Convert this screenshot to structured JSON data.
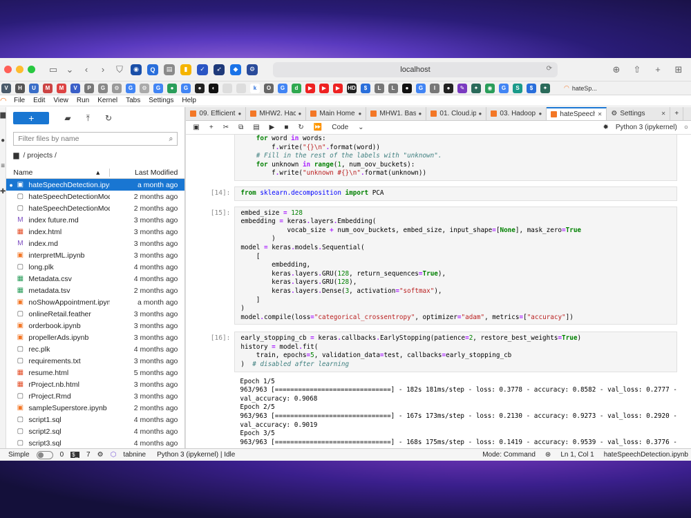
{
  "browser": {
    "address": "localhost",
    "traffic_colors": [
      "#ff5f57",
      "#febc2e",
      "#28c840"
    ]
  },
  "favorites": {
    "last_tab_label": "hateSp..."
  },
  "menu": [
    "File",
    "Edit",
    "View",
    "Run",
    "Kernel",
    "Tabs",
    "Settings",
    "Help"
  ],
  "filebrowser": {
    "new_label": "+",
    "filter_placeholder": "Filter files by name",
    "breadcrumb": "/ projects /",
    "col_name": "Name",
    "col_modified": "Last Modified",
    "files": [
      {
        "name": "hateSpeechDetection.ipynb",
        "modified": "a month ago",
        "icon": "notebook-icon",
        "selected": true
      },
      {
        "name": "hateSpeechDetectionModel.h5",
        "modified": "2 months ago",
        "icon": "file-icon"
      },
      {
        "name": "hateSpeechDetectionModelA...",
        "modified": "2 months ago",
        "icon": "file-icon"
      },
      {
        "name": "index future.md",
        "modified": "3 months ago",
        "icon": "markdown-icon"
      },
      {
        "name": "index.html",
        "modified": "3 months ago",
        "icon": "html-icon"
      },
      {
        "name": "index.md",
        "modified": "3 months ago",
        "icon": "markdown-icon"
      },
      {
        "name": "interpretML.ipynb",
        "modified": "3 months ago",
        "icon": "notebook-icon"
      },
      {
        "name": "long.plk",
        "modified": "4 months ago",
        "icon": "file-icon"
      },
      {
        "name": "Metadata.csv",
        "modified": "4 months ago",
        "icon": "csv-icon"
      },
      {
        "name": "metadata.tsv",
        "modified": "2 months ago",
        "icon": "csv-icon"
      },
      {
        "name": "noShowAppointment.ipynb",
        "modified": "a month ago",
        "icon": "notebook-icon"
      },
      {
        "name": "onlineRetail.feather",
        "modified": "3 months ago",
        "icon": "file-icon"
      },
      {
        "name": "orderbook.ipynb",
        "modified": "3 months ago",
        "icon": "notebook-icon"
      },
      {
        "name": "propellerAds.ipynb",
        "modified": "3 months ago",
        "icon": "notebook-icon"
      },
      {
        "name": "rec.plk",
        "modified": "4 months ago",
        "icon": "file-icon"
      },
      {
        "name": "requirements.txt",
        "modified": "3 months ago",
        "icon": "file-icon"
      },
      {
        "name": "resume.html",
        "modified": "5 months ago",
        "icon": "html-icon"
      },
      {
        "name": "rProject.nb.html",
        "modified": "3 months ago",
        "icon": "html-icon"
      },
      {
        "name": "rProject.Rmd",
        "modified": "3 months ago",
        "icon": "file-icon"
      },
      {
        "name": "sampleSuperstore.ipynb",
        "modified": "2 months ago",
        "icon": "notebook-icon"
      },
      {
        "name": "script1.sql",
        "modified": "4 months ago",
        "icon": "file-icon"
      },
      {
        "name": "script2.sql",
        "modified": "4 months ago",
        "icon": "file-icon"
      },
      {
        "name": "script3.sql",
        "modified": "4 months ago",
        "icon": "file-icon"
      }
    ]
  },
  "tabs": [
    {
      "label": "09. Efficient",
      "active": false
    },
    {
      "label": "MHW2. Hac",
      "active": false
    },
    {
      "label": "Main Home",
      "active": false
    },
    {
      "label": "MHW1. Basl",
      "active": false
    },
    {
      "label": "01. Cloud.ip",
      "active": false
    },
    {
      "label": "03. Hadoop",
      "active": false
    },
    {
      "label": "hateSpeech",
      "active": true
    },
    {
      "label": "Settings",
      "active": false
    }
  ],
  "nb_toolbar": {
    "cell_type": "Code",
    "kernel": "Python 3 (ipykernel)"
  },
  "cells": {
    "c14_prompt": "[14]:",
    "c15_prompt": "[15]:",
    "c16_prompt": "[16]:"
  },
  "output_lines": [
    "Epoch 1/5",
    "963/963 [==============================] - 182s 181ms/step - loss: 0.3778 - accuracy: 0.8582 - val_loss: 0.2777 -",
    "val_accuracy: 0.9068",
    "Epoch 2/5",
    "963/963 [==============================] - 167s 173ms/step - loss: 0.2130 - accuracy: 0.9273 - val_loss: 0.2920 -",
    "val_accuracy: 0.9019",
    "Epoch 3/5",
    "963/963 [==============================] - 168s 175ms/step - loss: 0.1419 - accuracy: 0.9539 - val_loss: 0.3776 -"
  ],
  "status": {
    "mode_label": "Simple",
    "count_a": "0",
    "count_b": "7",
    "tabnine": "tabnine",
    "kernel": "Python 3 (ipykernel) | Idle",
    "mode": "Mode: Command",
    "position": "Ln 1, Col 1",
    "file": "hateSpeechDetection.ipynb"
  }
}
